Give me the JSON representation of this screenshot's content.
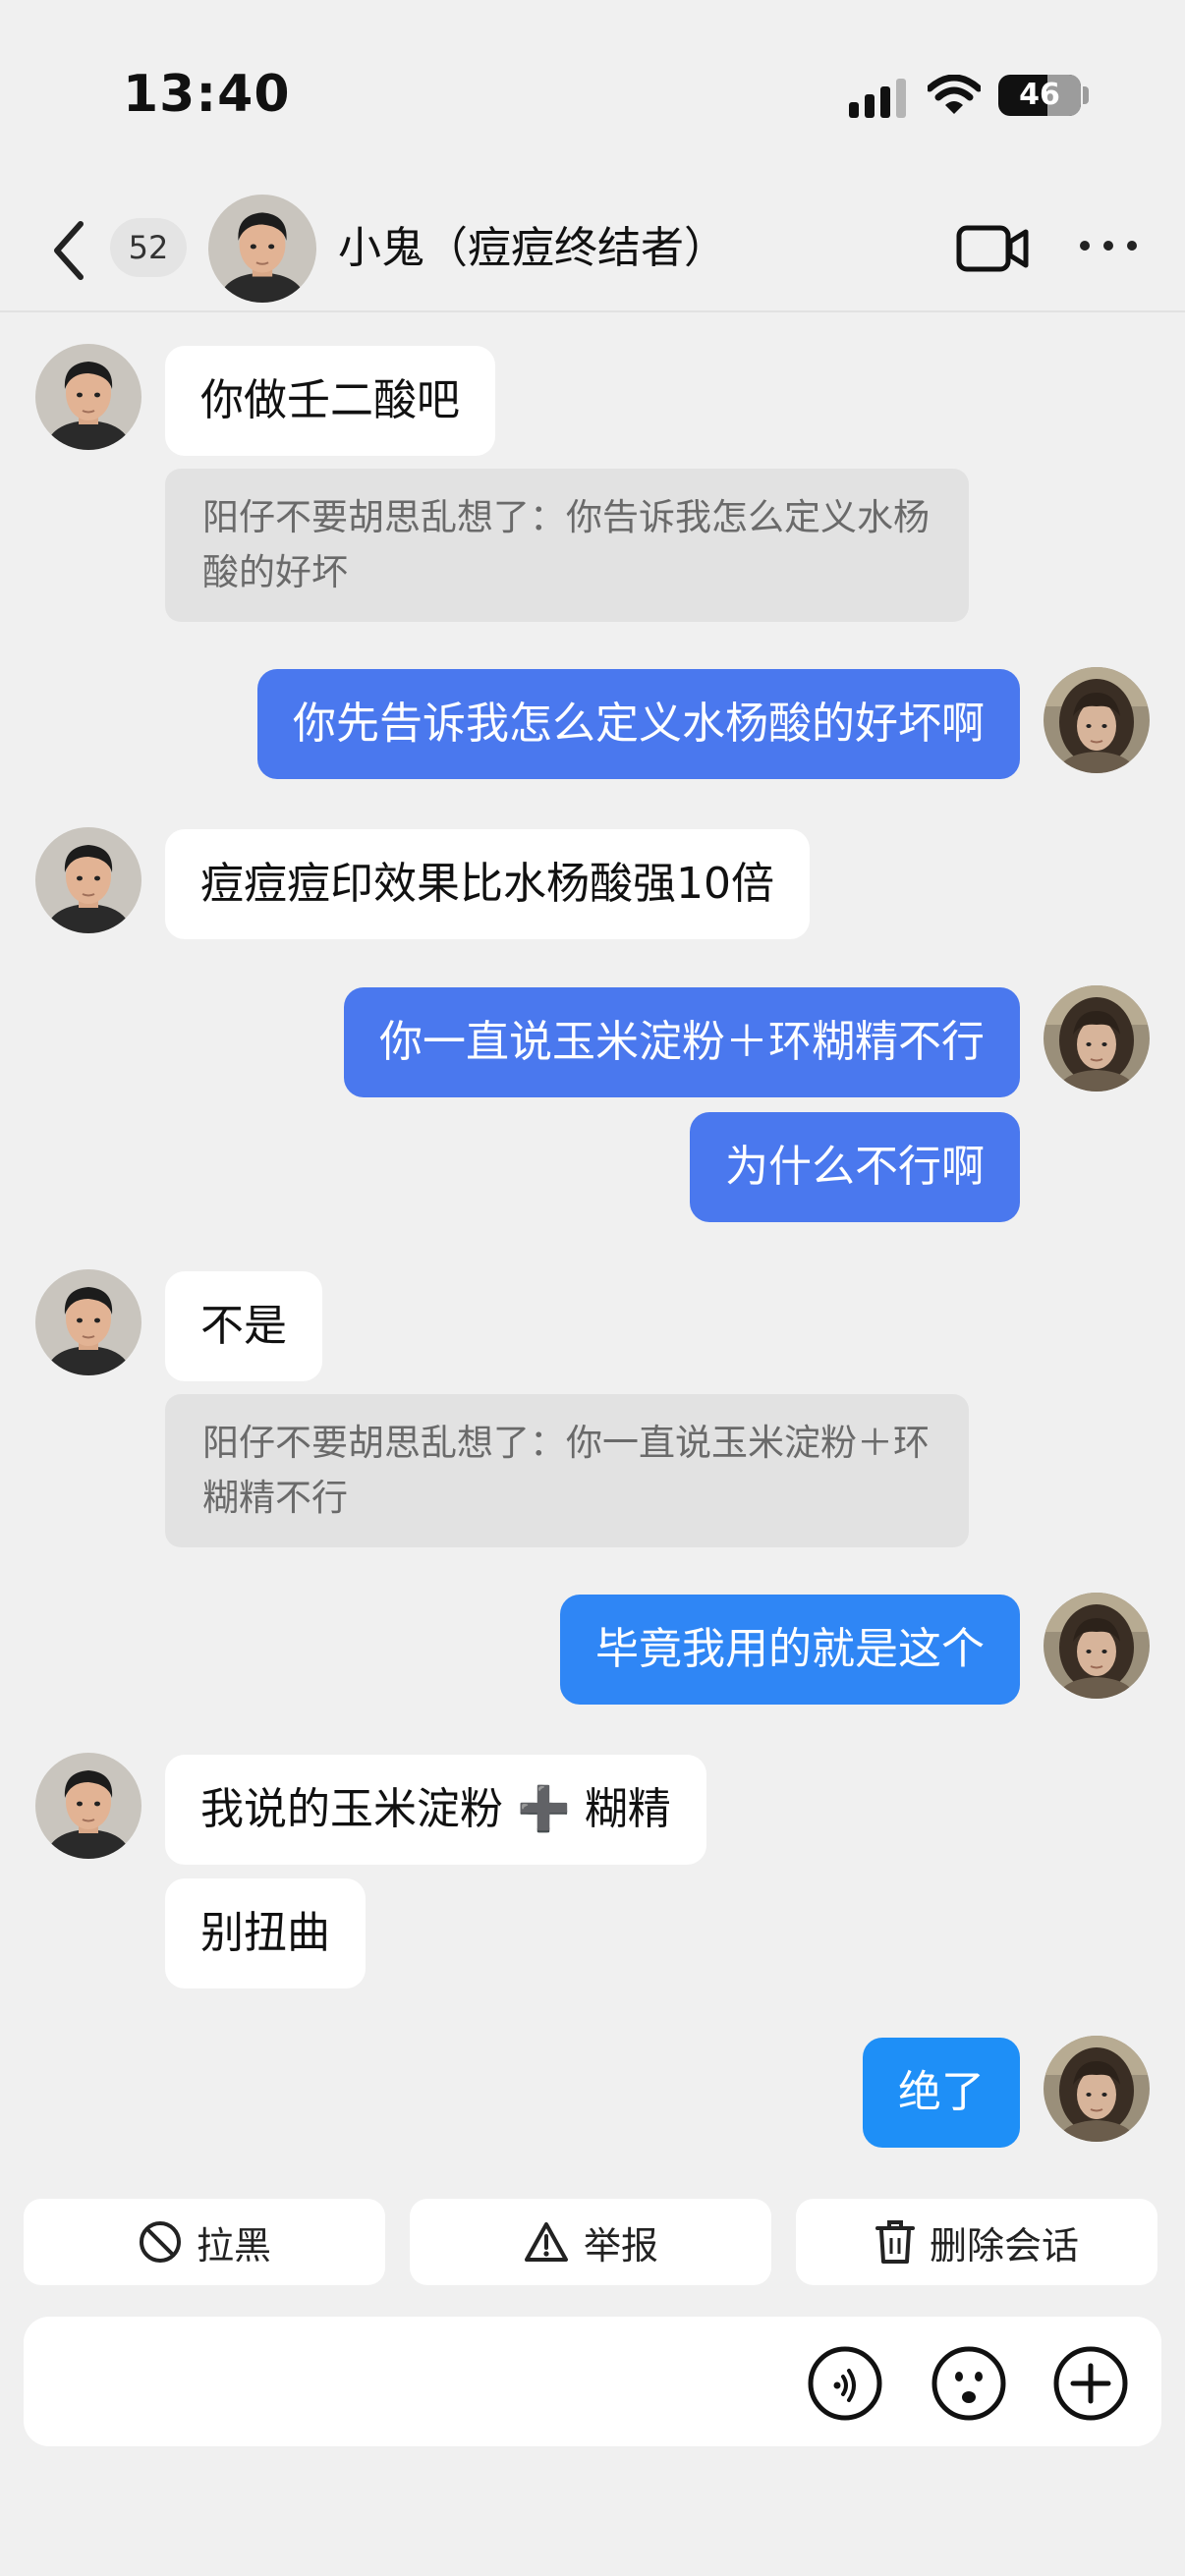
{
  "status_bar": {
    "time": "13:40",
    "battery": "46"
  },
  "nav": {
    "unread_count": "52",
    "title": "小鬼（痘痘终结者）"
  },
  "messages": [
    {
      "text": "你做壬二酸吧"
    },
    {
      "quote": "阳仔不要胡思乱想了：你告诉我怎么定义水杨酸的好坏"
    },
    {
      "text": "你先告诉我怎么定义水杨酸的好坏啊"
    },
    {
      "text": "痘痘痘印效果比水杨酸强10倍"
    },
    {
      "text": "你一直说玉米淀粉＋环糊精不行"
    },
    {
      "text": "为什么不行啊"
    },
    {
      "text": "不是"
    },
    {
      "quote": "阳仔不要胡思乱想了：你一直说玉米淀粉＋环糊精不行"
    },
    {
      "text": "毕竟我用的就是这个"
    },
    {
      "text": "我说的玉米淀粉 ➕ 糊精"
    },
    {
      "text": "别扭曲"
    },
    {
      "text": "绝了"
    }
  ],
  "actions": {
    "block_label": "拉黑",
    "report_label": "举报",
    "delete_label": "删除会话"
  },
  "input": {
    "value": "",
    "placeholder": ""
  },
  "icons": {
    "back": "chevron-left-icon",
    "video": "video-camera-icon",
    "more": "more-dots-icon",
    "block": "block-circle-icon",
    "report": "warning-triangle-icon",
    "delete": "trash-icon",
    "voice": "voice-icon",
    "emoji": "emoji-icon",
    "add": "plus-circle-icon"
  },
  "colors": {
    "outgoing_bubble": "#4a78ee",
    "outgoing_bubble_alt": "#2f86f5",
    "incoming_bubble": "#ffffff",
    "background": "#f0f0f0"
  }
}
